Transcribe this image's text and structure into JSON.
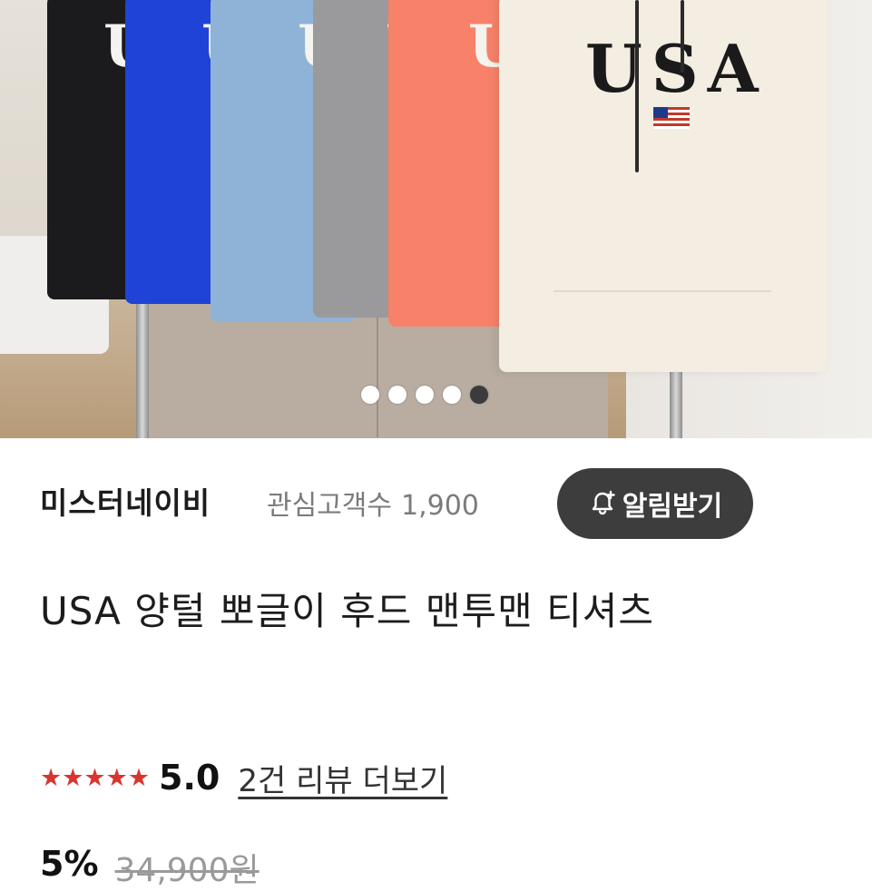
{
  "gallery": {
    "hoodie_letters": [
      "U",
      "U",
      "U",
      "U",
      "U"
    ],
    "featured_print": "USA",
    "dot_count": 5,
    "active_dot": 5
  },
  "store": {
    "name": "미스터네이비",
    "fans_label": "관심고객수",
    "fans_count": "1,900",
    "notify_label": "알림받기",
    "notify_icon": "bell-plus-icon"
  },
  "product": {
    "title": "USA 양털 뽀글이 후드 맨투맨 티셔츠"
  },
  "rating": {
    "stars": "★★★★★",
    "score": "5.0",
    "review_link": "2건 리뷰 더보기"
  },
  "price": {
    "discount": "5%",
    "original": "34,900원"
  },
  "colors": {
    "button_bg": "#3d3d3d",
    "star_color": "#d9352f",
    "muted_text": "#7b7b7b"
  }
}
